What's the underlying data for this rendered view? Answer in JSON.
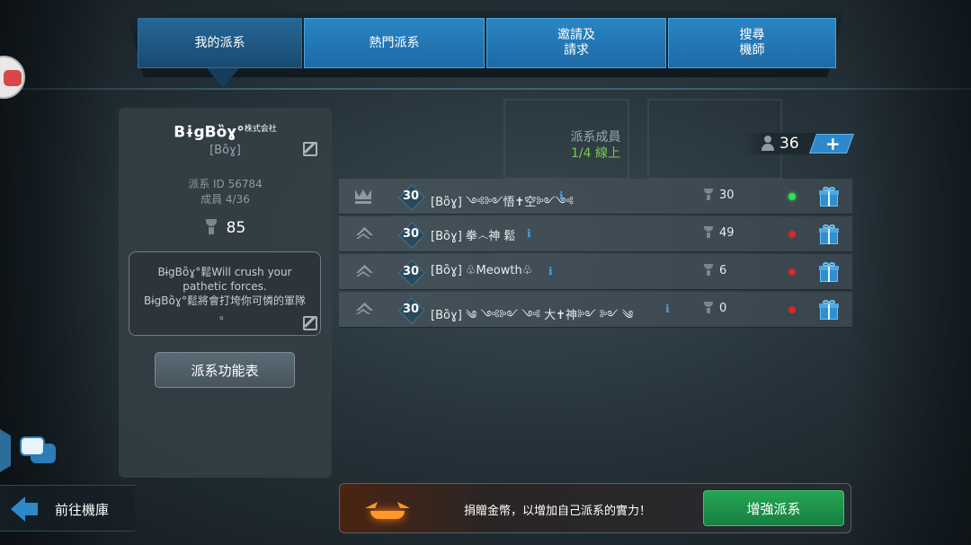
{
  "tabs": [
    {
      "label": "我的派系",
      "active": true
    },
    {
      "label": "熱門派系",
      "active": false
    },
    {
      "label": "邀請及\n請求",
      "active": false
    },
    {
      "label": "搜尋\n機師",
      "active": false
    }
  ],
  "clan": {
    "name": "BɨgBȍɣ°",
    "name_suffix": "株式会社",
    "tag": "[Bȍɣ]",
    "id_label": "派系 ID 56784",
    "members_label": "成員 4/36",
    "trophies": "85",
    "description": "BɨgBȍɣ°鬆Will crush your pathetic forces.\nBɨgBȍɣ°鬆將會打垮你可憐的軍隊\n。",
    "function_button": "派系功能表"
  },
  "members_header": {
    "title": "派系成員",
    "online": "1/4 線上",
    "count": "36",
    "add_label": "+"
  },
  "members": [
    {
      "rank": "crown",
      "level": "30",
      "name": "[Bȍɣ] ༺༻悟✝空༻༺",
      "trophies": "30",
      "online": true
    },
    {
      "rank": "chevron",
      "level": "30",
      "name": "[Bȍɣ] 拳෴神 鬆",
      "trophies": "49",
      "online": false
    },
    {
      "rank": "chevron",
      "level": "30",
      "name": "[Bȍɣ] ♧Meowth♧",
      "trophies": "6",
      "online": false
    },
    {
      "rank": "chevron",
      "level": "30",
      "name": "[Bȍɣ] ༄ ༺༻ ༺ 大✝神༻ ༻ ༄",
      "trophies": "0",
      "online": false
    }
  ],
  "back_label": "前往機庫",
  "donate_text": "捐贈金幣，以增加自己派系的實力！",
  "boost_button": "增強派系",
  "colors": {
    "online": "#2ee05a",
    "offline": "#e02424",
    "accent_blue": "#2a85c4",
    "boost_green": "#1f9a4c"
  },
  "icons": {
    "info": "ℹ",
    "edit": "pencil-square",
    "trophy": "trophy",
    "gift": "gift-box",
    "chat": "chat-bubbles",
    "back": "arrow-left"
  }
}
